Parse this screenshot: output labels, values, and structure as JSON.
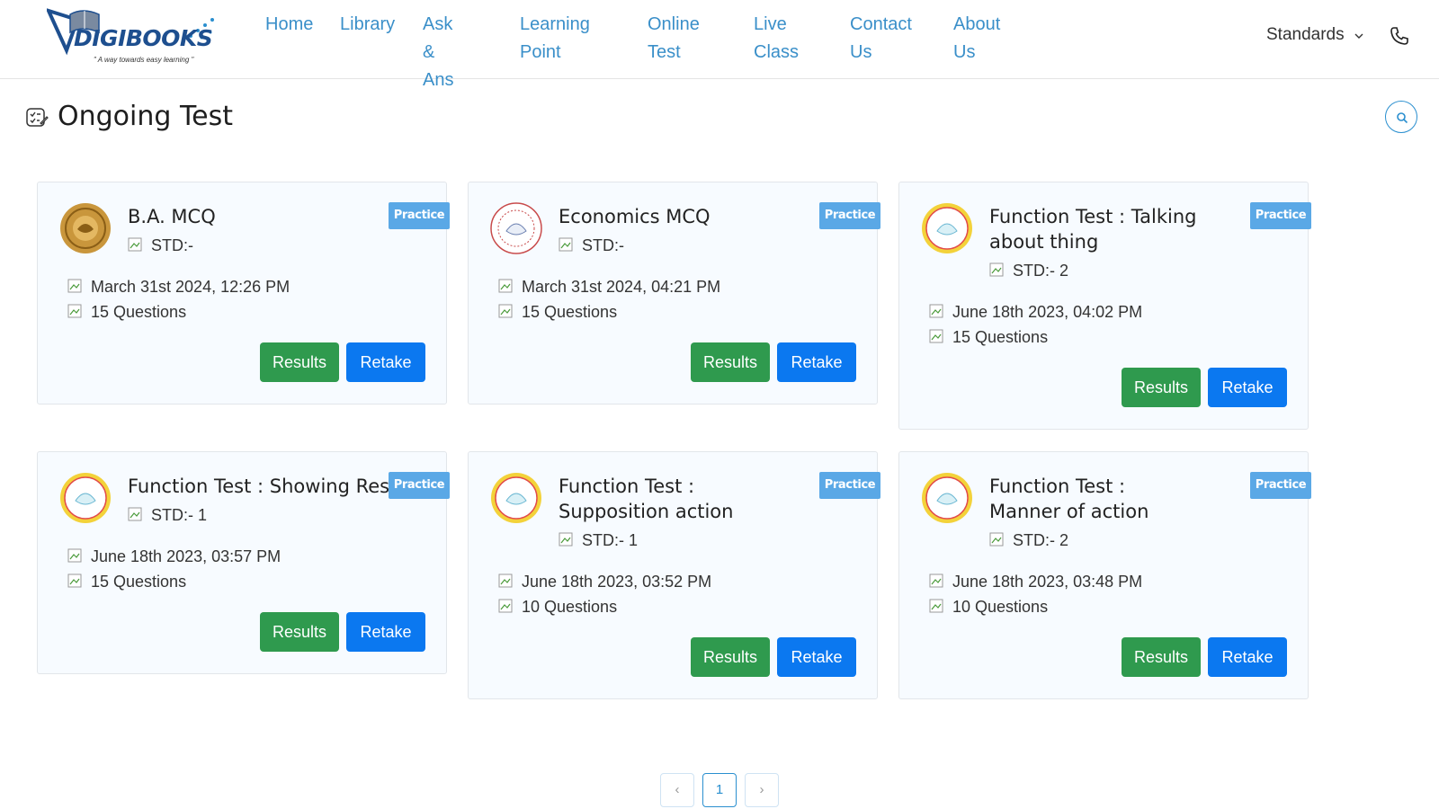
{
  "header": {
    "logo_text": "DIGIBOOKS",
    "logo_tagline": "\" A way towards easy learning \"",
    "nav": [
      {
        "line1": "Home",
        "line2": ""
      },
      {
        "line1": "Library",
        "line2": ""
      },
      {
        "line1": "Ask &",
        "line2": "Ans"
      },
      {
        "line1": "Learning",
        "line2": "Point"
      },
      {
        "line1": "Online",
        "line2": "Test"
      },
      {
        "line1": "Live",
        "line2": "Class"
      },
      {
        "line1": "Contact",
        "line2": "Us"
      },
      {
        "line1": "About",
        "line2": "Us"
      }
    ],
    "standards_label": "Standards",
    "icons": {
      "phone": "phone-icon",
      "chevron": "chevron-down-icon"
    }
  },
  "page": {
    "title": "Ongoing Test",
    "title_icon": "test-list-icon",
    "search_icon": "search-icon"
  },
  "tests": [
    {
      "title": "B.A. MCQ",
      "badge": "Practice",
      "std": "STD:-",
      "date": "March 31st 2024, 12:26 PM",
      "questions": "15 Questions",
      "results_label": "Results",
      "retake_label": "Retake"
    },
    {
      "title": "Economics MCQ",
      "badge": "Practice",
      "std": "STD:-",
      "date": "March 31st 2024, 04:21 PM",
      "questions": "15 Questions",
      "results_label": "Results",
      "retake_label": "Retake"
    },
    {
      "title": "Function Test : Talking about thing",
      "badge": "Practice",
      "std": "STD:- 2",
      "date": "June 18th 2023, 04:02 PM",
      "questions": "15 Questions",
      "results_label": "Results",
      "retake_label": "Retake"
    },
    {
      "title": "Function Test : Showing Res",
      "badge": "Practice",
      "std": "STD:- 1",
      "date": "June 18th 2023, 03:57 PM",
      "questions": "15 Questions",
      "results_label": "Results",
      "retake_label": "Retake"
    },
    {
      "title": "Function Test : Supposition action",
      "badge": "Practice",
      "std": "STD:- 1",
      "date": "June 18th 2023, 03:52 PM",
      "questions": "10 Questions",
      "results_label": "Results",
      "retake_label": "Retake"
    },
    {
      "title": "Function Test : Manner of action",
      "badge": "Practice",
      "std": "STD:- 2",
      "date": "June 18th 2023, 03:48 PM",
      "questions": "10 Questions",
      "results_label": "Results",
      "retake_label": "Retake"
    }
  ],
  "pagination": {
    "prev": "‹",
    "current": "1",
    "next": "›"
  },
  "colors": {
    "accent": "#2a8fcf",
    "results": "#2f9a4e",
    "retake": "#0b78f0",
    "badge": "#5aa8e6",
    "card_bg": "#f7fbff"
  }
}
